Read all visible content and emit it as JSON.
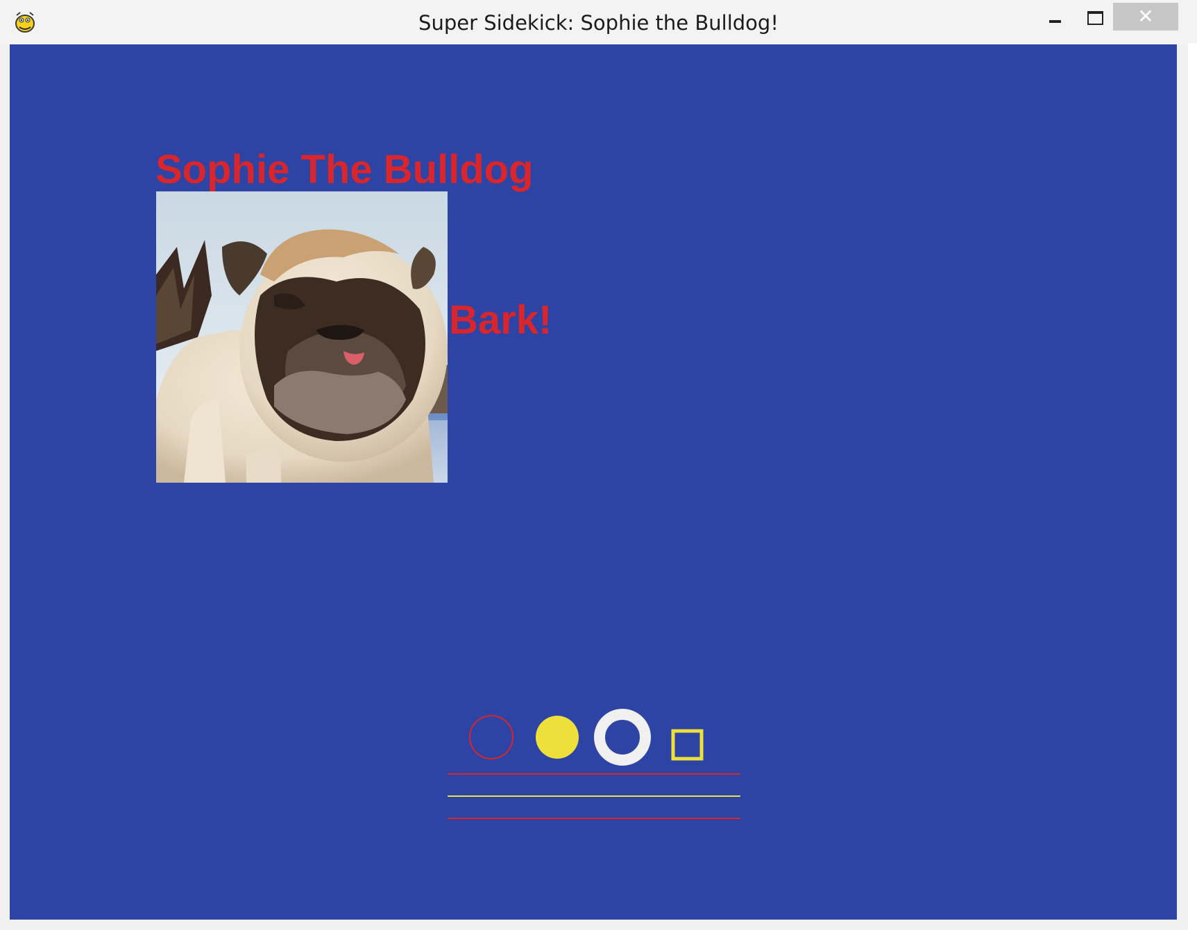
{
  "window": {
    "title": "Super Sidekick: Sophie the Bulldog!",
    "app_icon": "pygame-snake-icon",
    "controls": {
      "minimize_icon": "minimize-icon",
      "maximize_icon": "maximize-icon",
      "close_icon": "close-icon",
      "close_glyph": "✕"
    }
  },
  "canvas": {
    "background_color": "#2e44a4",
    "heading": "Sophie The Bulldog",
    "speech": "Bark!",
    "text_color": "#d8262c",
    "photo": "bulldog-photo",
    "shapes": [
      {
        "kind": "circle-outline",
        "color": "#d8262c"
      },
      {
        "kind": "circle-filled",
        "color": "#ede03a"
      },
      {
        "kind": "ring",
        "color": "#f0f0f0"
      },
      {
        "kind": "square-outline",
        "color": "#ede03a"
      },
      {
        "kind": "line",
        "color": "#d8262c"
      },
      {
        "kind": "line",
        "color": "#ede03a"
      },
      {
        "kind": "line",
        "color": "#d8262c"
      }
    ]
  }
}
